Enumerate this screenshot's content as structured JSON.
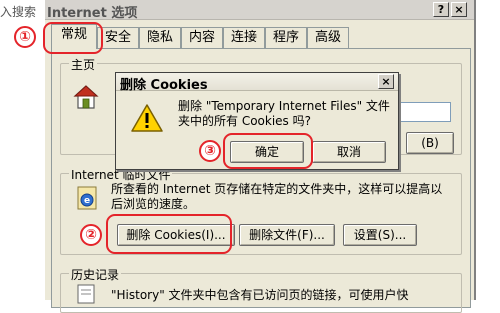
{
  "background_window": {
    "search_text": "入搜索"
  },
  "dialog": {
    "title": "Internet 选项",
    "help_btn": "?",
    "close_btn": "×",
    "tabs": [
      "常规",
      "安全",
      "隐私",
      "内容",
      "连接",
      "程序",
      "高级"
    ],
    "homepage": {
      "label": "主页"
    },
    "temp_files": {
      "label": "Internet 临时文件",
      "description": "所查看的 Internet 页存储在特定的文件夹中，这样可以提高以后浏览的速度。",
      "delete_cookies_btn": "删除 Cookies(I)...",
      "delete_files_btn": "删除文件(F)...",
      "settings_btn": "设置(S)..."
    },
    "history": {
      "label": "历史记录",
      "description": "\"History\" 文件夹中包含有已访问页的链接，可使用户快"
    },
    "partial_button_b": "(B)"
  },
  "popup": {
    "title": "删除 Cookies",
    "close_btn": "×",
    "message": "删除 \"Temporary Internet Files\" 文件夹中的所有 Cookies 吗?",
    "ok_btn": "确定",
    "cancel_btn": "取消"
  },
  "annotations": {
    "step1": "①",
    "step2": "②",
    "step3": "③",
    "color": "#e4242a"
  }
}
